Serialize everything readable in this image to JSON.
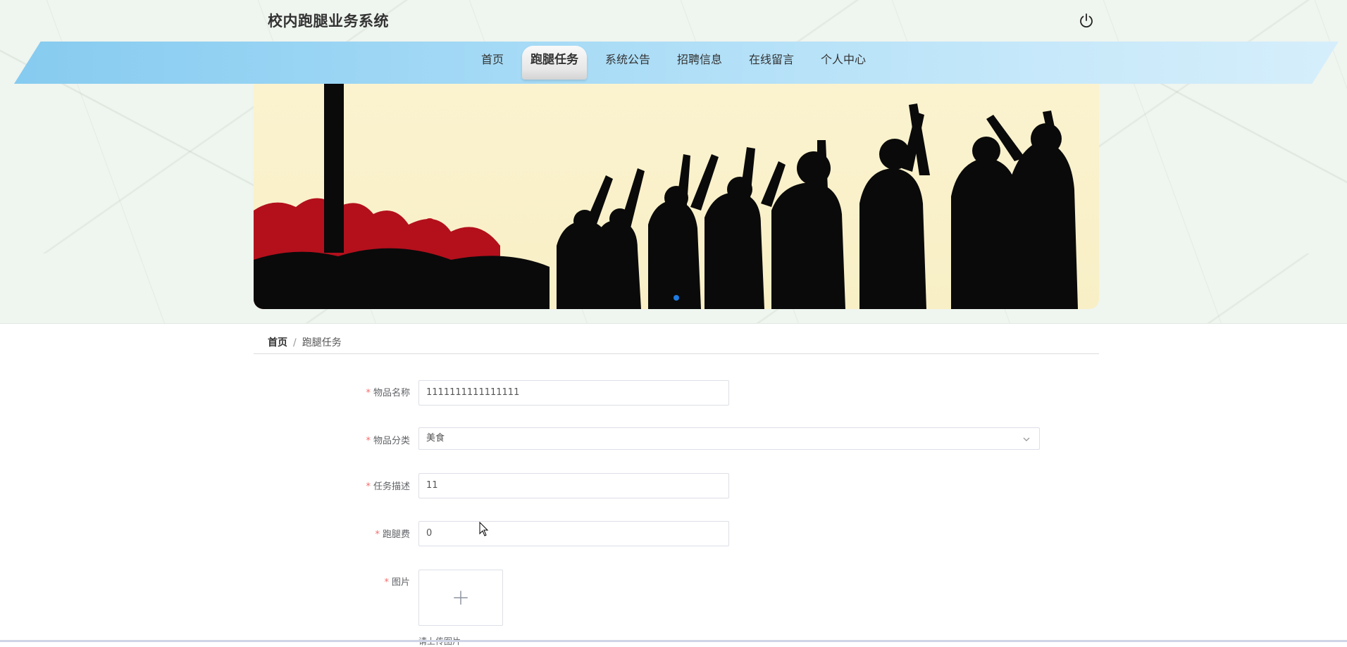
{
  "app": {
    "title": "校内跑腿业务系统"
  },
  "header": {
    "logout_icon": "power-icon"
  },
  "nav": {
    "items": [
      {
        "label": "首页"
      },
      {
        "label": "跑腿任务",
        "active": true
      },
      {
        "label": "系统公告"
      },
      {
        "label": "招聘信息"
      },
      {
        "label": "在线留言"
      },
      {
        "label": "个人中心"
      }
    ],
    "gradient_colors": [
      "#86cbf0",
      "#d6eefb"
    ]
  },
  "banner": {
    "indicator_color": "#1e7be0"
  },
  "breadcrumb": {
    "home": "首页",
    "separator": "/",
    "current": "跑腿任务"
  },
  "form": {
    "required_mark": "*",
    "item_name": {
      "label": "物品名称",
      "value": "1111111111111111"
    },
    "category": {
      "label": "物品分类",
      "value": "美食"
    },
    "description": {
      "label": "任务描述",
      "value": "11"
    },
    "fee": {
      "label": "跑腿费",
      "value": "0"
    },
    "image": {
      "label": "图片",
      "upload_icon": "plus-icon",
      "hint": "请上传图片"
    }
  },
  "colors": {
    "required": "#f56c6c",
    "border": "#dcdfe6"
  }
}
